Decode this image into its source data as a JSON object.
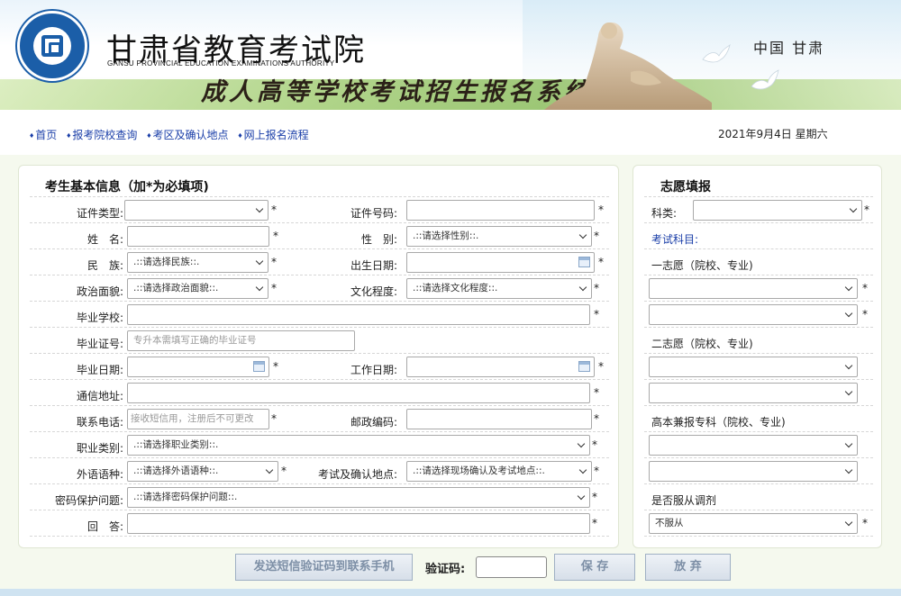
{
  "header": {
    "org_name": "甘肃省教育考试院",
    "org_name_en": "GANSU PROVINCIAL EDUCATION EXAMINATIONS AUTHORITY",
    "system_title": "成人高等学校考试招生报名系统",
    "place": "中国 甘肃"
  },
  "nav": {
    "items": [
      "首页",
      "报考院校查询",
      "考区及确认地点",
      "网上报名流程"
    ]
  },
  "date_text": "2021年9月4日 星期六",
  "basic_info": {
    "title": "考生基本信息（加*为必填项)",
    "id_type_label": "证件类型:",
    "id_number_label": "证件号码:",
    "name_label": "姓　名:",
    "gender_label": "性　别:",
    "gender_value": ".::请选择性别::.",
    "ethnicity_label": "民　族:",
    "ethnicity_value": ".::请选择民族::.",
    "birth_label": "出生日期:",
    "political_label": "政治面貌:",
    "political_value": ".::请选择政治面貌::.",
    "education_label": "文化程度:",
    "education_value": ".::请选择文化程度::.",
    "school_label": "毕业学校:",
    "cert_label": "毕业证号:",
    "cert_placeholder": "专升本需填写正确的毕业证号",
    "grad_date_label": "毕业日期:",
    "work_date_label": "工作日期:",
    "address_label": "通信地址:",
    "phone_label": "联系电话:",
    "phone_placeholder": "接收短信用，注册后不可更改",
    "postcode_label": "邮政编码:",
    "occupation_label": "职业类别:",
    "occupation_value": ".::请选择职业类别::.",
    "language_label": "外语语种:",
    "language_value": ".::请选择外语语种::.",
    "exam_site_label": "考试及确认地点:",
    "exam_site_value": ".::请选择现场确认及考试地点::.",
    "question_label": "密码保护问题:",
    "question_value": ".::请选择密码保护问题::.",
    "answer_label": "回　答:",
    "required_mark": "*"
  },
  "wish": {
    "title": "志愿填报",
    "category_label": "科类:",
    "subjects_label": "考试科目:",
    "first_label": "一志愿（院校、专业)",
    "second_label": "二志愿（院校、专业)",
    "combined_label": "高本兼报专科（院校、专业)",
    "adjust_label": "是否服从调剂",
    "adjust_value": "不服从"
  },
  "actions": {
    "send_sms": "发送短信验证码到联系手机",
    "captcha_label": "验证码:",
    "save": "保 存",
    "discard": "放 弃"
  }
}
